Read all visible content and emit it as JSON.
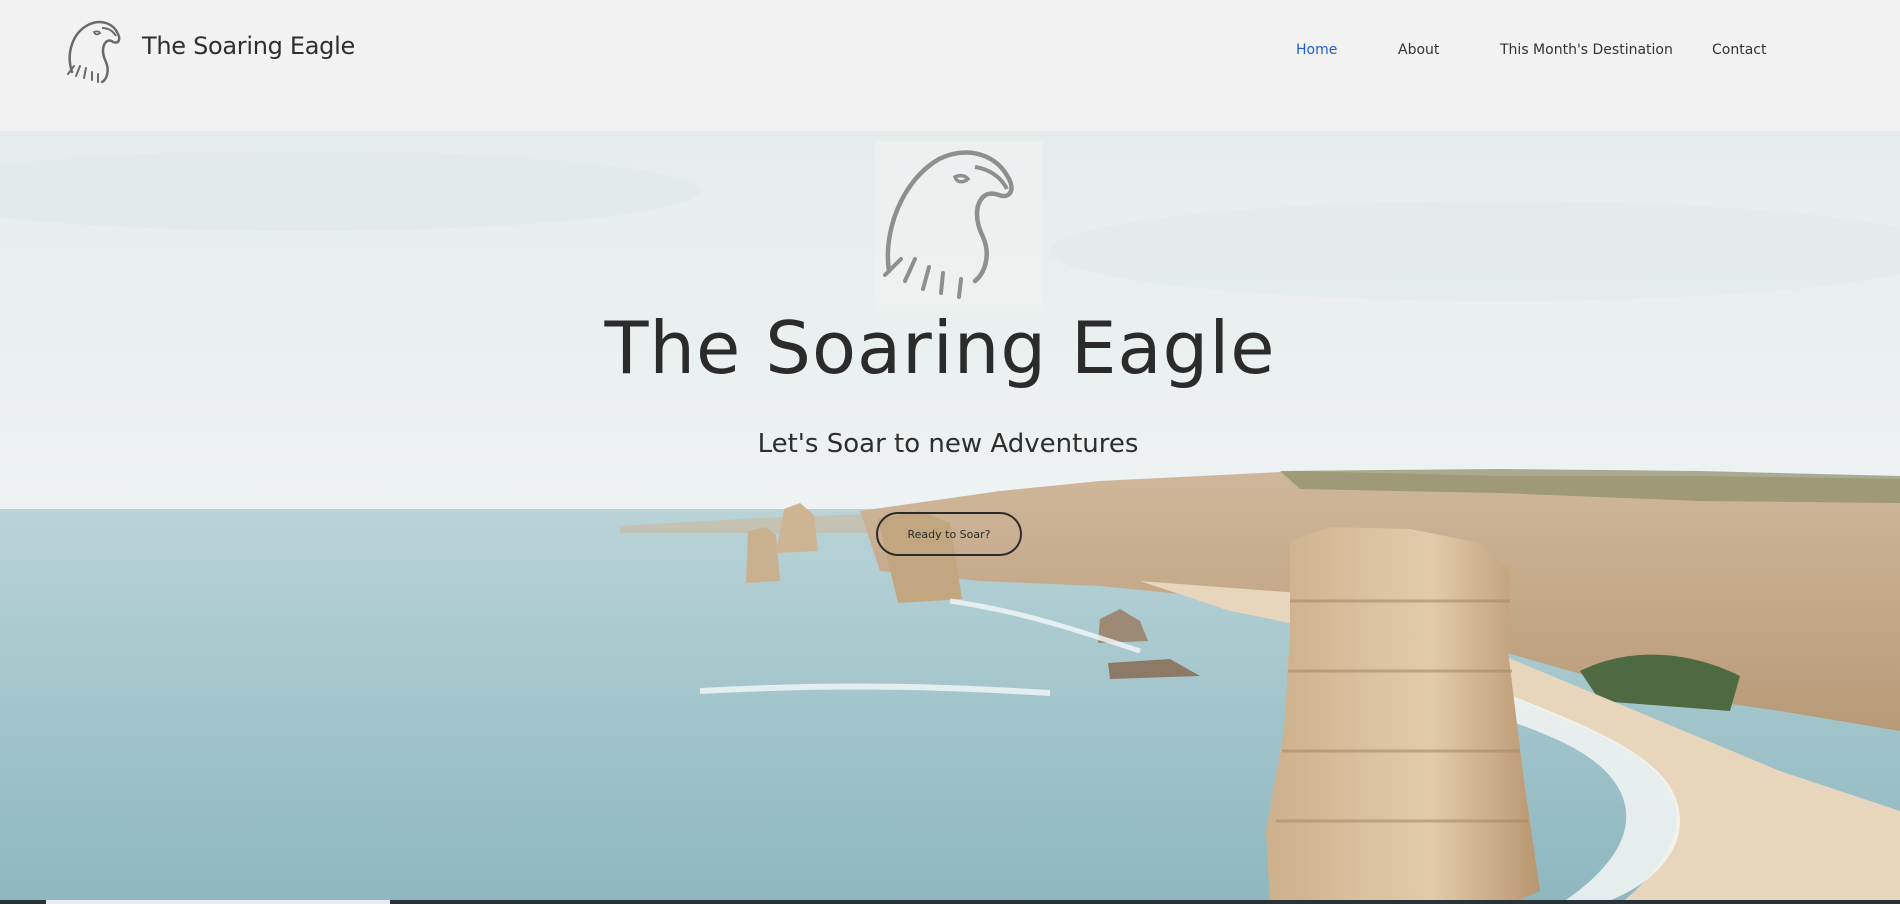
{
  "header": {
    "site_name": "The Soaring Eagle",
    "logo_icon": "eagle-head-icon",
    "nav": [
      {
        "label": "Home",
        "active": true
      },
      {
        "label": "About",
        "active": false
      },
      {
        "label": "This Month's Destination",
        "active": false
      },
      {
        "label": "Contact",
        "active": false
      }
    ]
  },
  "hero": {
    "logo_icon": "eagle-head-icon",
    "title": "The Soaring Eagle",
    "subtitle": "Let's Soar to new Adventures",
    "cta_label": "Ready to Soar?",
    "background": "coastal-cliffs-sea-stacks-photo"
  },
  "colors": {
    "header_bg": "#f2f2f2",
    "active_nav": "#1f5bd6",
    "text": "#2b2b2b"
  }
}
